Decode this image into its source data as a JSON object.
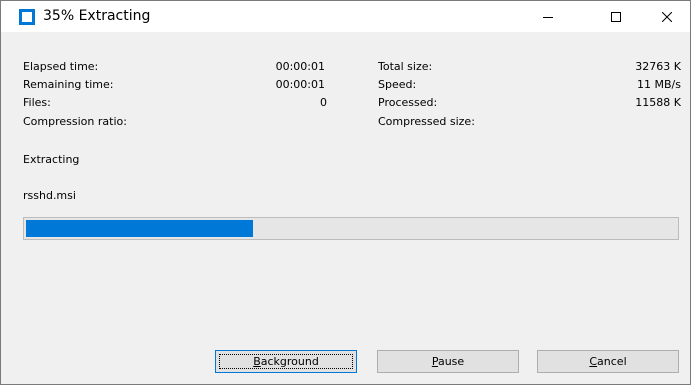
{
  "window": {
    "title": "35% Extracting",
    "accent_color": "#0078d7",
    "controls": [
      "minimize-icon",
      "maximize-icon",
      "close-icon"
    ]
  },
  "stats": {
    "elapsed_label": "Elapsed time:",
    "elapsed_value": "00:00:01",
    "remaining_label": "Remaining time:",
    "remaining_value": "00:00:01",
    "files_label": "Files:",
    "files_value": "0",
    "ratio_label": "Compression ratio:",
    "total_label": "Total size:",
    "total_value": "32763 K",
    "speed_label": "Speed:",
    "speed_value": "11 MB/s",
    "processed_label": "Processed:",
    "processed_value": "11588 K",
    "compressed_label": "Compressed size:"
  },
  "status": {
    "operation": "Extracting",
    "current_file": "rsshd.msi"
  },
  "progress": {
    "fraction": 0.35,
    "fill_color": "#0078d7"
  },
  "buttons": {
    "background": "Background",
    "pause": "Pause",
    "cancel": "Cancel"
  }
}
